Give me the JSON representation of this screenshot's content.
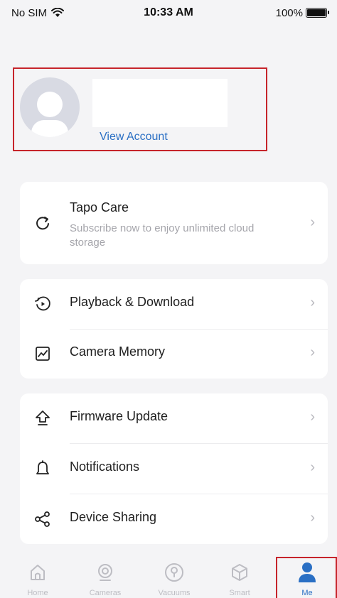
{
  "status_bar": {
    "carrier": "No SIM",
    "time": "10:33 AM",
    "battery": "100%"
  },
  "profile": {
    "view_account": "View Account"
  },
  "tapo_care": {
    "title": "Tapo Care",
    "subtitle": "Subscribe now to enjoy unlimited cloud storage"
  },
  "menu_group_1": [
    {
      "label": "Playback & Download",
      "icon": "playback-icon"
    },
    {
      "label": "Camera Memory",
      "icon": "chart-icon"
    }
  ],
  "menu_group_2": [
    {
      "label": "Firmware Update",
      "icon": "upload-arrow-icon"
    },
    {
      "label": "Notifications",
      "icon": "bell-icon"
    },
    {
      "label": "Device Sharing",
      "icon": "share-icon"
    }
  ],
  "tabs": [
    {
      "label": "Home",
      "icon": "home-icon",
      "active": false
    },
    {
      "label": "Cameras",
      "icon": "camera-icon",
      "active": false
    },
    {
      "label": "Vacuums",
      "icon": "vacuum-icon",
      "active": false
    },
    {
      "label": "Smart",
      "icon": "cube-icon",
      "active": false
    },
    {
      "label": "Me",
      "icon": "person-icon",
      "active": true
    }
  ],
  "colors": {
    "accent": "#2a6fc4",
    "highlight": "#c6242b",
    "background": "#f4f4f6"
  }
}
